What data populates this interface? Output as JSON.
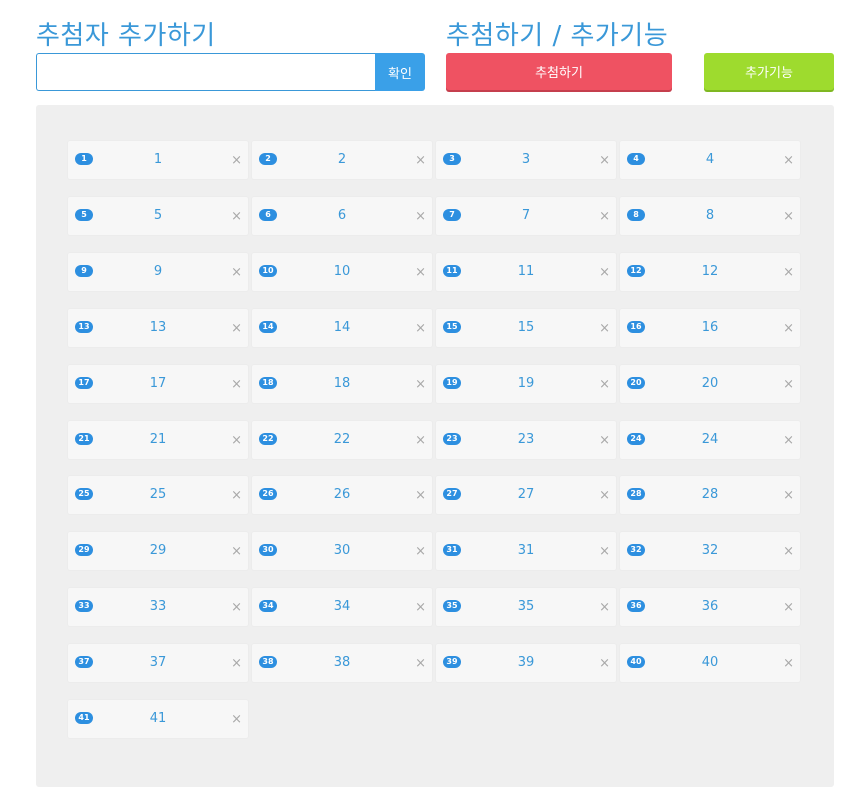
{
  "header": {
    "add_title": "추첨자 추가하기",
    "draw_title": "추첨하기 / 추가기능"
  },
  "form": {
    "name_input_value": "",
    "confirm_label": "확인"
  },
  "actions": {
    "draw_label": "추첨하기",
    "extra_label": "추가기능"
  },
  "participants": [
    {
      "num": "1",
      "name": "1"
    },
    {
      "num": "2",
      "name": "2"
    },
    {
      "num": "3",
      "name": "3"
    },
    {
      "num": "4",
      "name": "4"
    },
    {
      "num": "5",
      "name": "5"
    },
    {
      "num": "6",
      "name": "6"
    },
    {
      "num": "7",
      "name": "7"
    },
    {
      "num": "8",
      "name": "8"
    },
    {
      "num": "9",
      "name": "9"
    },
    {
      "num": "10",
      "name": "10"
    },
    {
      "num": "11",
      "name": "11"
    },
    {
      "num": "12",
      "name": "12"
    },
    {
      "num": "13",
      "name": "13"
    },
    {
      "num": "14",
      "name": "14"
    },
    {
      "num": "15",
      "name": "15"
    },
    {
      "num": "16",
      "name": "16"
    },
    {
      "num": "17",
      "name": "17"
    },
    {
      "num": "18",
      "name": "18"
    },
    {
      "num": "19",
      "name": "19"
    },
    {
      "num": "20",
      "name": "20"
    },
    {
      "num": "21",
      "name": "21"
    },
    {
      "num": "22",
      "name": "22"
    },
    {
      "num": "23",
      "name": "23"
    },
    {
      "num": "24",
      "name": "24"
    },
    {
      "num": "25",
      "name": "25"
    },
    {
      "num": "26",
      "name": "26"
    },
    {
      "num": "27",
      "name": "27"
    },
    {
      "num": "28",
      "name": "28"
    },
    {
      "num": "29",
      "name": "29"
    },
    {
      "num": "30",
      "name": "30"
    },
    {
      "num": "31",
      "name": "31"
    },
    {
      "num": "32",
      "name": "32"
    },
    {
      "num": "33",
      "name": "33"
    },
    {
      "num": "34",
      "name": "34"
    },
    {
      "num": "35",
      "name": "35"
    },
    {
      "num": "36",
      "name": "36"
    },
    {
      "num": "37",
      "name": "37"
    },
    {
      "num": "38",
      "name": "38"
    },
    {
      "num": "39",
      "name": "39"
    },
    {
      "num": "40",
      "name": "40"
    },
    {
      "num": "41",
      "name": "41"
    }
  ],
  "remove_glyph": "×",
  "colors": {
    "accent": "#3a98d8",
    "draw_button": "#ef5262",
    "extra_button": "#9edb2e",
    "badge": "#2d8fe0"
  },
  "icons": {
    "remove": "close-icon"
  }
}
